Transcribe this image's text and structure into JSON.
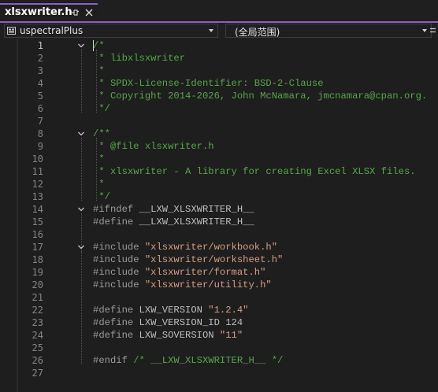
{
  "tab": {
    "title": "xlsxwriter.h"
  },
  "navbar": {
    "project": "uspectralPlus",
    "scope": "(全局范围)"
  },
  "editor": {
    "lines": [
      {
        "n": "1",
        "fold": true,
        "segs": [
          {
            "c": "cm",
            "t": "/*"
          }
        ]
      },
      {
        "n": "2",
        "segs": [
          {
            "c": "cm",
            "t": " * libxlsxwriter"
          }
        ]
      },
      {
        "n": "3",
        "segs": [
          {
            "c": "cm",
            "t": " *"
          }
        ]
      },
      {
        "n": "4",
        "segs": [
          {
            "c": "cm",
            "t": " * SPDX-License-Identifier: BSD-2-Clause"
          }
        ]
      },
      {
        "n": "5",
        "segs": [
          {
            "c": "cm",
            "t": " * Copyright 2014-2026, John McNamara, jmcnamara@cpan.org."
          }
        ]
      },
      {
        "n": "6",
        "segs": [
          {
            "c": "cm",
            "t": " */"
          }
        ]
      },
      {
        "n": "7",
        "segs": []
      },
      {
        "n": "8",
        "fold": true,
        "segs": [
          {
            "c": "cm",
            "t": "/**"
          }
        ]
      },
      {
        "n": "9",
        "segs": [
          {
            "c": "cm",
            "t": " * @file xlsxwriter.h"
          }
        ]
      },
      {
        "n": "10",
        "segs": [
          {
            "c": "cm",
            "t": " *"
          }
        ]
      },
      {
        "n": "11",
        "segs": [
          {
            "c": "cm",
            "t": " * xlsxwriter - A library for creating Excel XLSX files."
          }
        ]
      },
      {
        "n": "12",
        "segs": [
          {
            "c": "cm",
            "t": " *"
          }
        ]
      },
      {
        "n": "13",
        "segs": [
          {
            "c": "cm",
            "t": " */"
          }
        ]
      },
      {
        "n": "14",
        "fold": true,
        "segs": [
          {
            "c": "pp",
            "t": "#ifndef "
          },
          {
            "c": "mac",
            "t": "__LXW_XLSXWRITER_H__"
          }
        ]
      },
      {
        "n": "15",
        "segs": [
          {
            "c": "pp",
            "t": "#define "
          },
          {
            "c": "mac",
            "t": "__LXW_XLSXWRITER_H__"
          }
        ]
      },
      {
        "n": "16",
        "segs": []
      },
      {
        "n": "17",
        "fold": true,
        "segs": [
          {
            "c": "pp",
            "t": "#include "
          },
          {
            "c": "str",
            "t": "\"xlsxwriter/workbook.h\""
          }
        ]
      },
      {
        "n": "18",
        "segs": [
          {
            "c": "pp",
            "t": "#include "
          },
          {
            "c": "str",
            "t": "\"xlsxwriter/worksheet.h\""
          }
        ]
      },
      {
        "n": "19",
        "segs": [
          {
            "c": "pp",
            "t": "#include "
          },
          {
            "c": "str",
            "t": "\"xlsxwriter/format.h\""
          }
        ]
      },
      {
        "n": "20",
        "segs": [
          {
            "c": "pp",
            "t": "#include "
          },
          {
            "c": "str",
            "t": "\"xlsxwriter/utility.h\""
          }
        ]
      },
      {
        "n": "21",
        "segs": []
      },
      {
        "n": "22",
        "segs": [
          {
            "c": "pp",
            "t": "#define "
          },
          {
            "c": "mac",
            "t": "LXW_VERSION "
          },
          {
            "c": "str",
            "t": "\"1.2.4\""
          }
        ]
      },
      {
        "n": "23",
        "segs": [
          {
            "c": "pp",
            "t": "#define "
          },
          {
            "c": "mac",
            "t": "LXW_VERSION_ID 124"
          }
        ]
      },
      {
        "n": "24",
        "segs": [
          {
            "c": "pp",
            "t": "#define "
          },
          {
            "c": "mac",
            "t": "LXW_SOVERSION "
          },
          {
            "c": "str",
            "t": "\"11\""
          }
        ]
      },
      {
        "n": "25",
        "segs": []
      },
      {
        "n": "26",
        "segs": [
          {
            "c": "pp",
            "t": "#endif "
          },
          {
            "c": "cm",
            "t": "/* __LXW_XLSXWRITER_H__ */"
          }
        ]
      },
      {
        "n": "27",
        "segs": []
      }
    ]
  },
  "colors": {
    "accent": "#8b5fc7",
    "comment": "#57a64a",
    "string": "#d69d85",
    "preprocessor": "#9b9b9b",
    "background": "#1e1e1e"
  }
}
